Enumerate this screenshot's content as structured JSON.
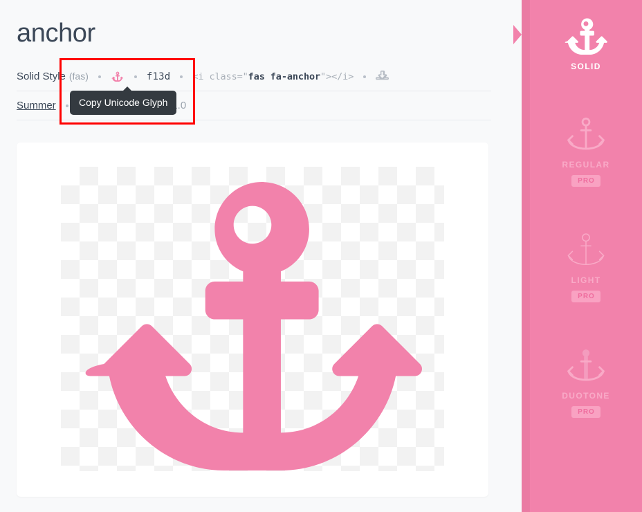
{
  "page": {
    "title": "anchor",
    "background_color": "#f8f9fa",
    "accent_color": "#f282ab",
    "text_color": "#3c4858"
  },
  "meta": {
    "style_name": "Solid Style",
    "style_family": "(fas)",
    "glyph_icon": "anchor-icon",
    "unicode": "f13d",
    "html_snippet": {
      "open_prefix": "<i class=",
      "quote_open": "\"",
      "class_value": "fas fa-anchor",
      "quote_close": "\"",
      "open_suffix": ">",
      "close_tag": "</i>",
      "full": "<i class=\"fas fa-anchor\"></i>"
    },
    "download_icon": "download-tray-icon",
    "separator": "•"
  },
  "meta_row2": {
    "category_link": "Summer",
    "created_label": "Created: Version 5.11.0"
  },
  "tooltip": {
    "text": "Copy Unicode Glyph",
    "background_color": "#343a40",
    "text_color": "#ffffff"
  },
  "highlight": {
    "color": "#ff0000",
    "label": "annotation-box"
  },
  "preview": {
    "glyph_icon": "anchor-icon",
    "glyph_color": "#f282ab",
    "checker_color_a": "#ffffff",
    "checker_color_b": "#f2f2f2"
  },
  "sidebar": {
    "background_color": "#f282ab",
    "rail_color": "#ea7ba3",
    "items": [
      {
        "id": "solid",
        "label": "SOLID",
        "icon": "anchor-solid-icon",
        "state": "active",
        "pro": false,
        "pro_label": ""
      },
      {
        "id": "regular",
        "label": "REGULAR",
        "icon": "anchor-regular-icon",
        "state": "locked",
        "pro": true,
        "pro_label": "PRO"
      },
      {
        "id": "light",
        "label": "LIGHT",
        "icon": "anchor-light-icon",
        "state": "locked",
        "pro": true,
        "pro_label": "PRO"
      },
      {
        "id": "duotone",
        "label": "DUOTONE",
        "icon": "anchor-duotone-icon",
        "state": "locked",
        "pro": true,
        "pro_label": "PRO"
      }
    ]
  }
}
